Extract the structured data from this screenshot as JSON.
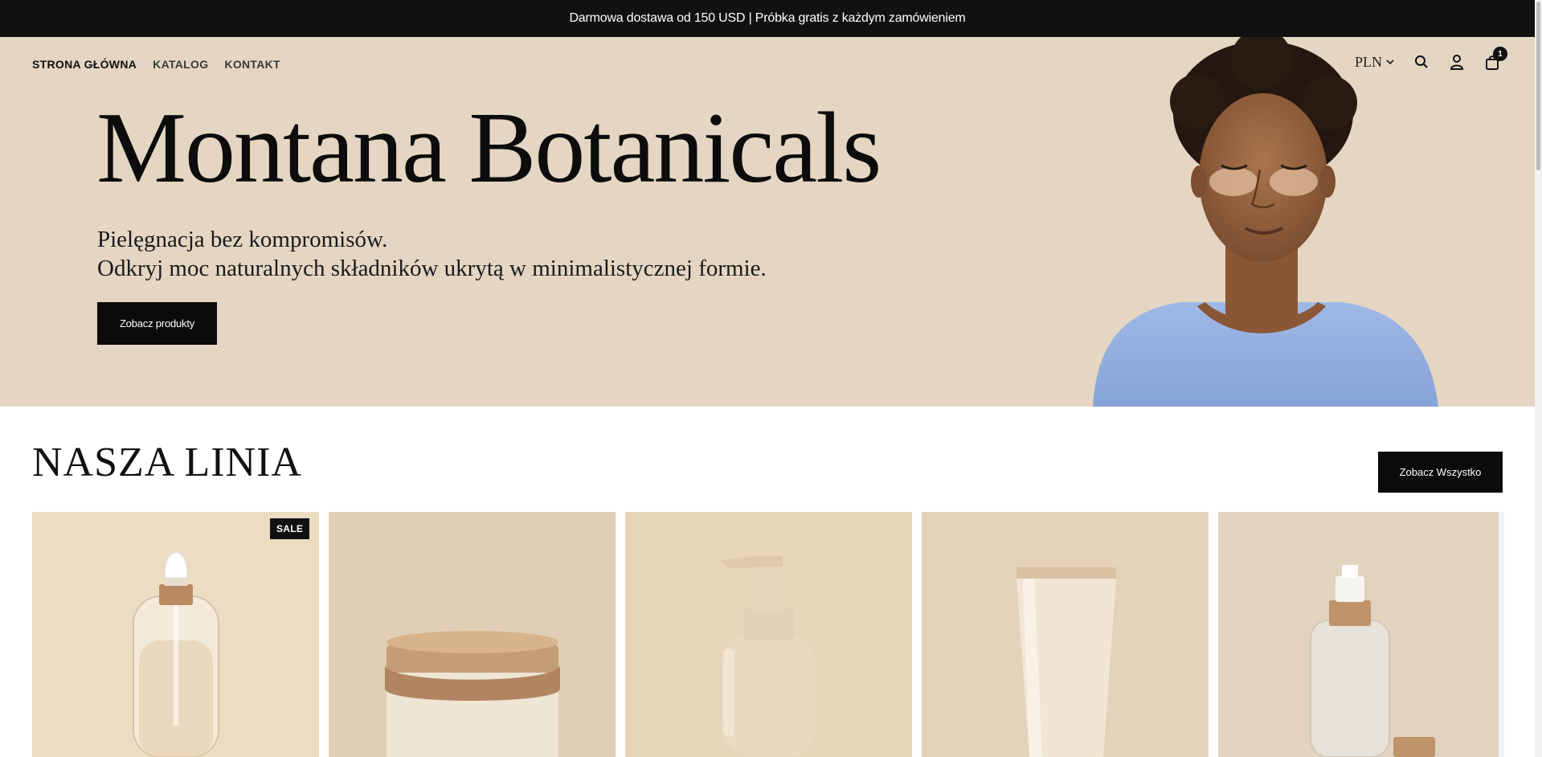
{
  "announcement": "Darmowa dostawa od 150 USD | Próbka gratis z każdym zamówieniem",
  "nav": [
    {
      "label": "STRONA GŁÓWNA"
    },
    {
      "label": "KATALOG"
    },
    {
      "label": "KONTAKT"
    }
  ],
  "header": {
    "currency": "PLN",
    "cart_count": "1",
    "icons": [
      "search-icon",
      "account-icon",
      "cart-icon",
      "chevron-down-icon"
    ]
  },
  "hero": {
    "title": "Montana Botanicals",
    "subtitle_line1": "Pielęgnacja bez kompromisów.",
    "subtitle_line2": "Odkryj moc naturalnych składników ukrytą w minimalistycznej formie.",
    "button_label": "Zobacz produkty"
  },
  "collection": {
    "title": "NASZA LINIA",
    "view_all_label": "Zobacz Wszystko",
    "products": [
      {
        "image": "dropper-serum-bottle",
        "badge": "SALE"
      },
      {
        "image": "cream-jar"
      },
      {
        "image": "pump-bottle"
      },
      {
        "image": "cream-tube"
      },
      {
        "image": "spray-bottle"
      }
    ]
  },
  "colors": {
    "hero_background": "#e4d6c2",
    "dark": "#0b0b0b",
    "announcement_background": "#111111"
  }
}
